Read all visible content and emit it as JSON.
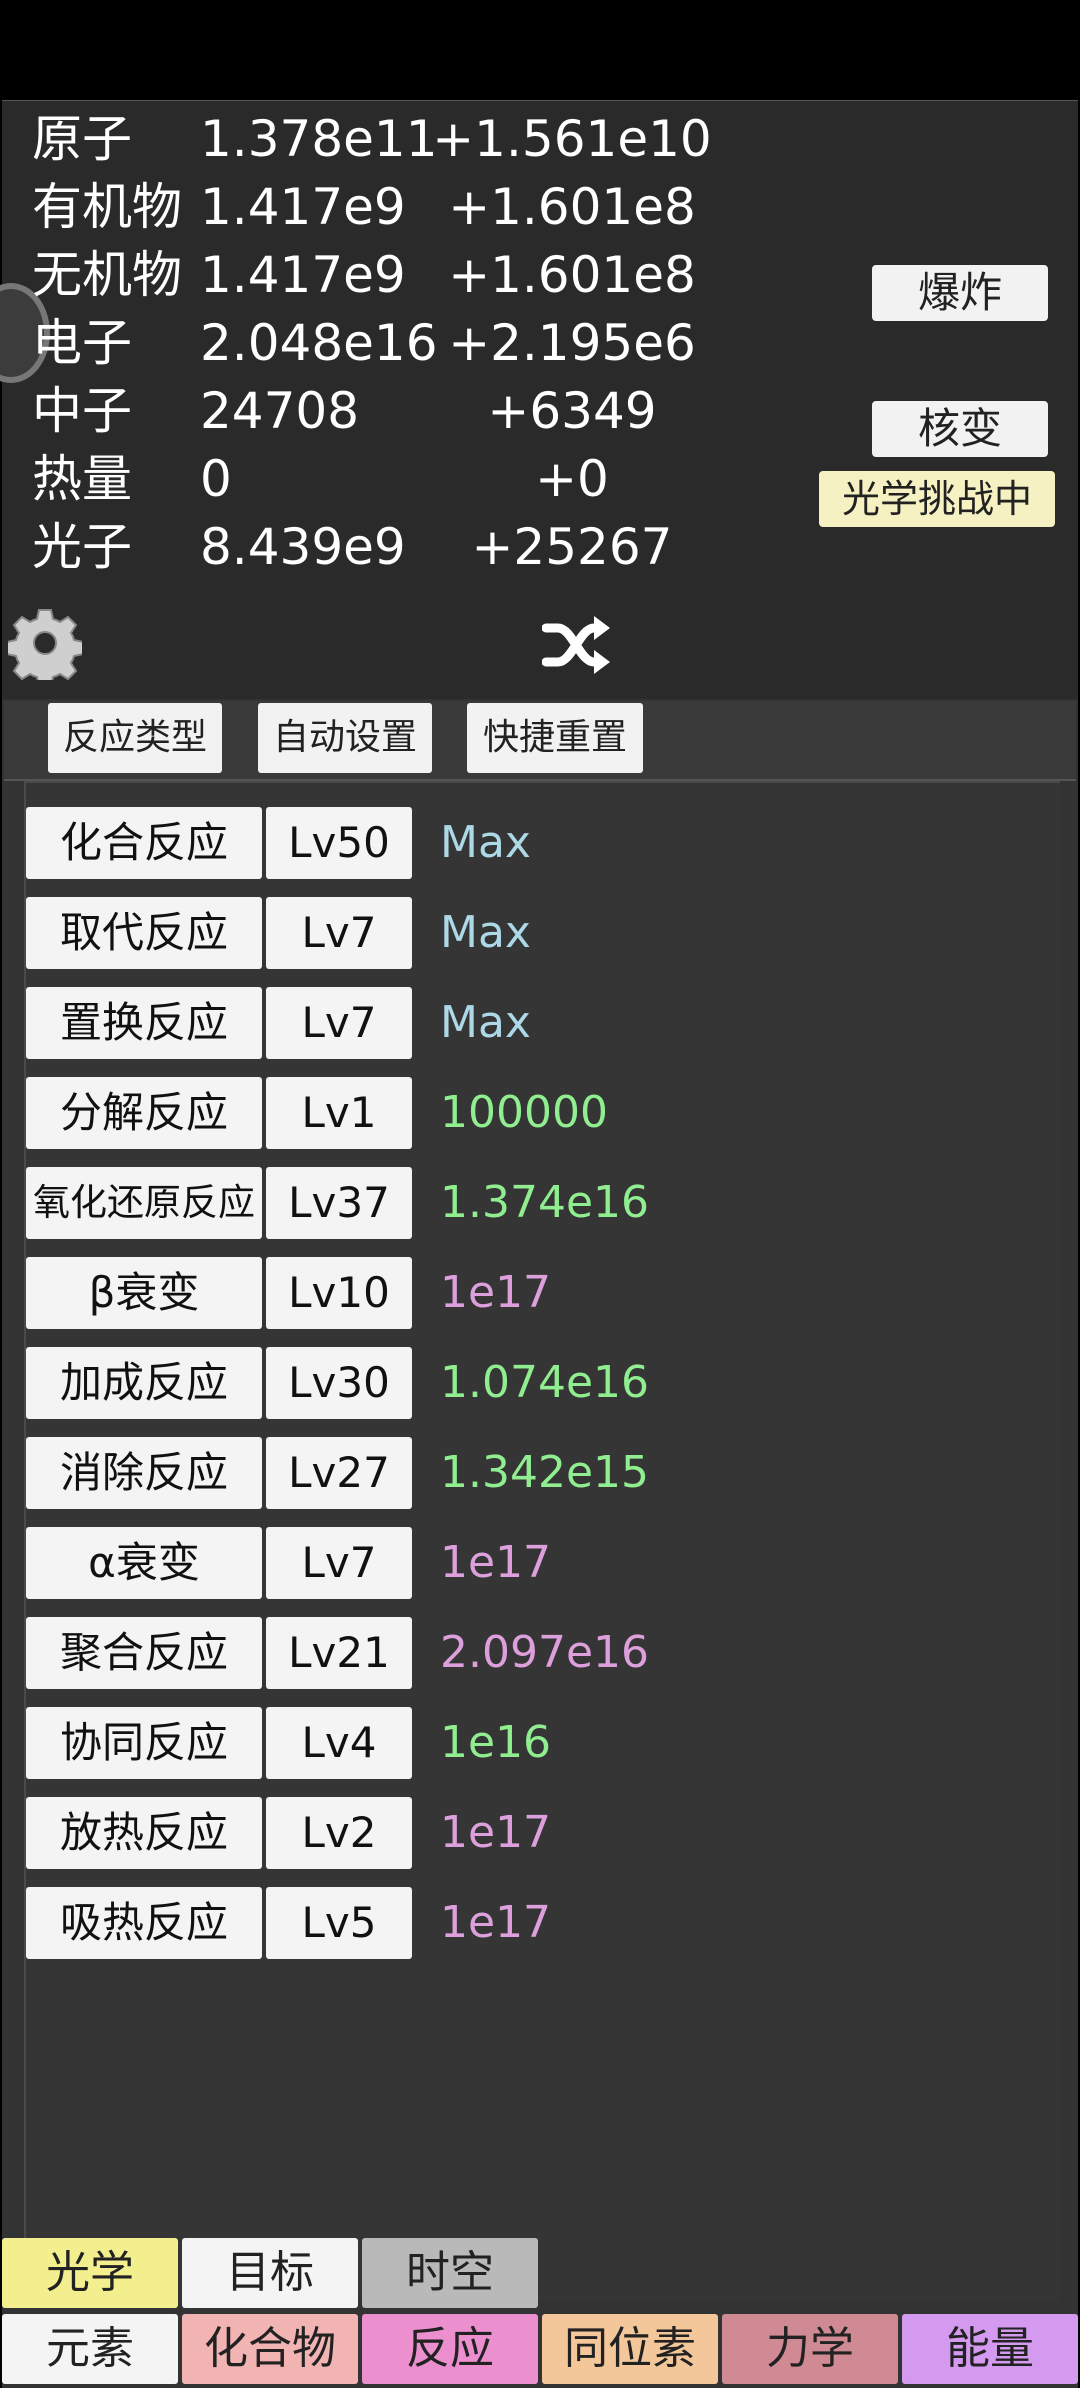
{
  "resources": [
    {
      "name": "原子",
      "value": "1.378e11",
      "rate": "+1.561e10"
    },
    {
      "name": "有机物",
      "value": "1.417e9",
      "rate": "+1.601e8"
    },
    {
      "name": "无机物",
      "value": "1.417e9",
      "rate": "+1.601e8"
    },
    {
      "name": "电子",
      "value": "2.048e16",
      "rate": "+2.195e6"
    },
    {
      "name": "中子",
      "value": "24708",
      "rate": "+6349"
    },
    {
      "name": "热量",
      "value": "0",
      "rate": "+0"
    },
    {
      "name": "光子",
      "value": "8.439e9",
      "rate": "+25267"
    }
  ],
  "side_buttons": {
    "explode": "爆炸",
    "fission": "核变",
    "challenge": "光学挑战中"
  },
  "icons": {
    "settings": "gear-icon",
    "shuffle": "shuffle-icon"
  },
  "sub_tabs": [
    "反应类型",
    "自动设置",
    "快捷重置"
  ],
  "reactions": [
    {
      "name": "化合反应",
      "level": "Lv50",
      "value": "Max",
      "color": "#add8e6"
    },
    {
      "name": "取代反应",
      "level": "Lv7",
      "value": "Max",
      "color": "#add8e6"
    },
    {
      "name": "置换反应",
      "level": "Lv7",
      "value": "Max",
      "color": "#add8e6"
    },
    {
      "name": "分解反应",
      "level": "Lv1",
      "value": "100000",
      "color": "#90ee90"
    },
    {
      "name": "氧化还原反应",
      "level": "Lv37",
      "value": "1.374e16",
      "color": "#90ee90"
    },
    {
      "name": "β衰变",
      "level": "Lv10",
      "value": "1e17",
      "color": "#dda0dd"
    },
    {
      "name": "加成反应",
      "level": "Lv30",
      "value": "1.074e16",
      "color": "#90ee90"
    },
    {
      "name": "消除反应",
      "level": "Lv27",
      "value": "1.342e15",
      "color": "#90ee90"
    },
    {
      "name": "α衰变",
      "level": "Lv7",
      "value": "1e17",
      "color": "#dda0dd"
    },
    {
      "name": "聚合反应",
      "level": "Lv21",
      "value": "2.097e16",
      "color": "#dda0dd"
    },
    {
      "name": "协同反应",
      "level": "Lv4",
      "value": "1e16",
      "color": "#90ee90"
    },
    {
      "name": "放热反应",
      "level": "Lv2",
      "value": "1e17",
      "color": "#dda0dd"
    },
    {
      "name": "吸热反应",
      "level": "Lv5",
      "value": "1e17",
      "color": "#dda0dd"
    }
  ],
  "bottom_tabs_row1": [
    {
      "label": "光学",
      "color": "#f3ef8f"
    },
    {
      "label": "目标",
      "color": "#f4f4f4"
    },
    {
      "label": "时空",
      "color": "#b9b9b9"
    }
  ],
  "bottom_tabs_row2": [
    {
      "label": "元素",
      "color": "#f4f4f4"
    },
    {
      "label": "化合物",
      "color": "#f2b3b3"
    },
    {
      "label": "反应",
      "color": "#ec8fcf"
    },
    {
      "label": "同位素",
      "color": "#f4c79b"
    },
    {
      "label": "力学",
      "color": "#cf8a93"
    },
    {
      "label": "能量",
      "color": "#d49af0"
    }
  ]
}
